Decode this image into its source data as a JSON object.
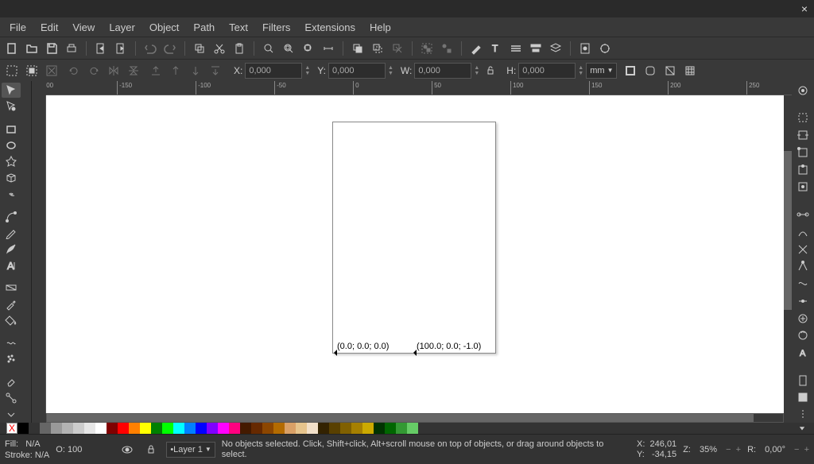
{
  "menu": {
    "file": "File",
    "edit": "Edit",
    "view": "View",
    "layer": "Layer",
    "object": "Object",
    "path": "Path",
    "text": "Text",
    "filters": "Filters",
    "extensions": "Extensions",
    "help": "Help"
  },
  "coords": {
    "x_lbl": "X:",
    "y_lbl": "Y:",
    "w_lbl": "W:",
    "h_lbl": "H:",
    "x": "0,000",
    "y": "0,000",
    "w": "0,000",
    "h": "0,000",
    "unit": "mm"
  },
  "canvas": {
    "annot_left": "(0.0; 0.0; 0.0)",
    "annot_right": "(100.0; 0.0; -1.0)"
  },
  "status": {
    "fill_lbl": "Fill:",
    "fill_val": "N/A",
    "stroke_lbl": "Stroke:",
    "stroke_val": "N/A",
    "o_lbl": "O:",
    "o_val": "100",
    "layer": "•Layer 1",
    "hint": "No objects selected. Click, Shift+click, Alt+scroll mouse on top of objects, or drag around objects to select.",
    "xl": "X:",
    "xv": "246,01",
    "yl": "Y:",
    "yv": "-34,15",
    "zl": "Z:",
    "zv": "35%",
    "rl": "R:",
    "rv": "0,00°"
  }
}
